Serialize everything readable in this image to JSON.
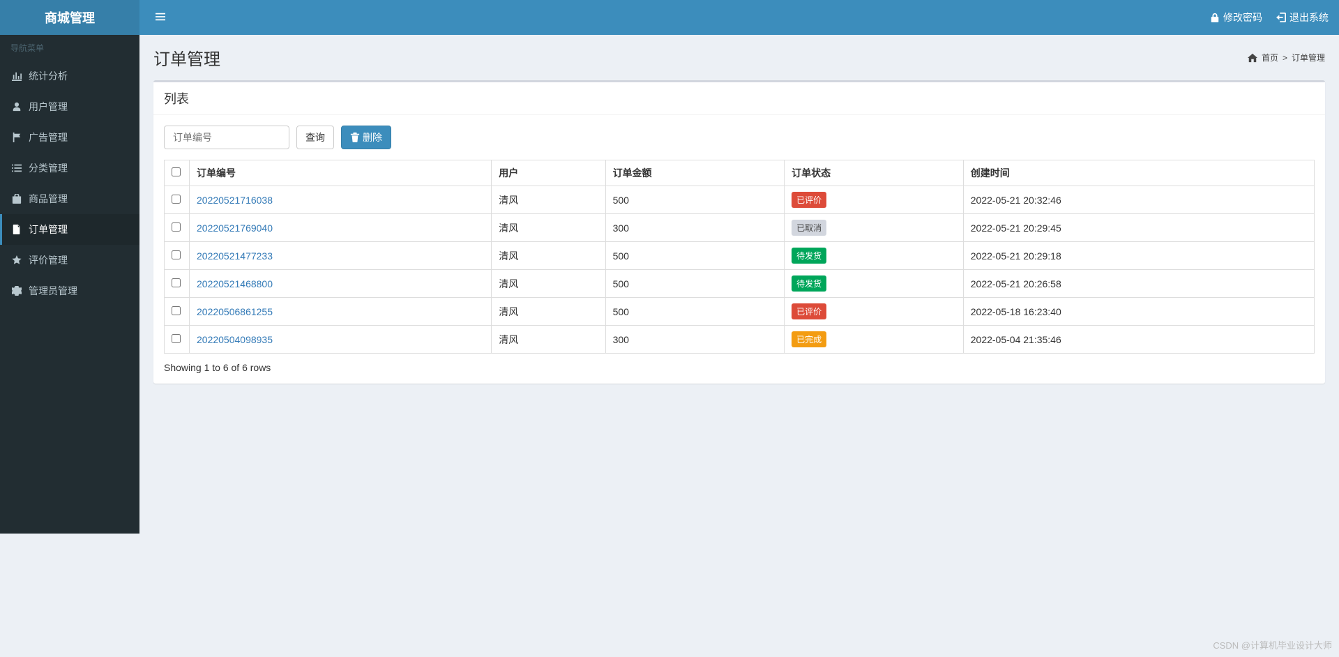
{
  "brand": "商城管理",
  "sidebar": {
    "title": "导航菜单",
    "items": [
      {
        "icon": "chart-bar-icon",
        "label": "统计分析"
      },
      {
        "icon": "user-icon",
        "label": "用户管理"
      },
      {
        "icon": "flag-icon",
        "label": "广告管理"
      },
      {
        "icon": "list-icon",
        "label": "分类管理"
      },
      {
        "icon": "bag-icon",
        "label": "商品管理"
      },
      {
        "icon": "file-icon",
        "label": "订单管理"
      },
      {
        "icon": "star-icon",
        "label": "评价管理"
      },
      {
        "icon": "gear-icon",
        "label": "管理员管理"
      }
    ],
    "activeIndex": 5
  },
  "topbar": {
    "change_password": "修改密码",
    "logout": "退出系统"
  },
  "page": {
    "title": "订单管理",
    "breadcrumb_home": "首页",
    "breadcrumb_current": "订单管理",
    "panel_title": "列表"
  },
  "toolbar": {
    "search_placeholder": "订单编号",
    "query_label": "查询",
    "delete_label": "删除"
  },
  "table": {
    "columns": {
      "order_no": "订单编号",
      "user": "用户",
      "amount": "订单金额",
      "status": "订单状态",
      "created": "创建时间"
    },
    "rows": [
      {
        "order_no": "20220521716038",
        "user": "清风",
        "amount": "500",
        "status": "已评价",
        "status_class": "label-danger",
        "created": "2022-05-21 20:32:46"
      },
      {
        "order_no": "20220521769040",
        "user": "清风",
        "amount": "300",
        "status": "已取消",
        "status_class": "label-default",
        "created": "2022-05-21 20:29:45"
      },
      {
        "order_no": "20220521477233",
        "user": "清风",
        "amount": "500",
        "status": "待发货",
        "status_class": "label-success",
        "created": "2022-05-21 20:29:18"
      },
      {
        "order_no": "20220521468800",
        "user": "清风",
        "amount": "500",
        "status": "待发货",
        "status_class": "label-success",
        "created": "2022-05-21 20:26:58"
      },
      {
        "order_no": "20220506861255",
        "user": "清风",
        "amount": "500",
        "status": "已评价",
        "status_class": "label-danger",
        "created": "2022-05-18 16:23:40"
      },
      {
        "order_no": "20220504098935",
        "user": "清风",
        "amount": "300",
        "status": "已完成",
        "status_class": "label-warning",
        "created": "2022-05-04 21:35:46"
      }
    ]
  },
  "pagination_info": "Showing 1 to 6 of 6 rows",
  "watermark": "CSDN @计算机毕业设计大师"
}
